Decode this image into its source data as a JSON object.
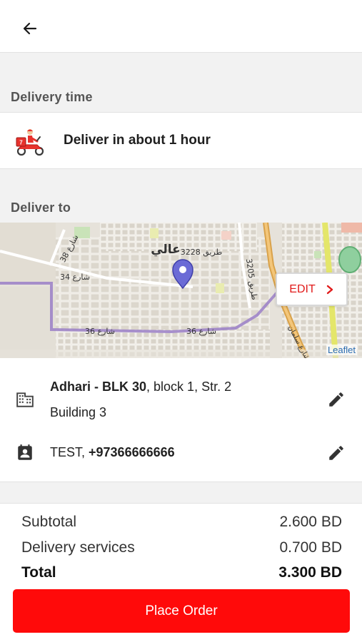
{
  "header": {
    "back_icon": "arrow-left-icon"
  },
  "delivery_time": {
    "section_label": "Delivery time",
    "text": "Deliver in about 1 hour",
    "icon": "delivery-scooter-icon"
  },
  "deliver_to": {
    "section_label": "Deliver to",
    "map": {
      "edit_label": "EDIT",
      "attribution": "Leaflet",
      "labels": {
        "area": "عالي",
        "road_3228": "طريق 3228",
        "road_3205": "طريق 3205",
        "street_34": "شارع 34",
        "street_36a": "شارع 36",
        "street_36b": "شارع 36",
        "street_38": "شارع 38",
        "street_salman": "شارع سلمان"
      }
    },
    "address": {
      "name_bold": "Adhari - BLK 30",
      "name_rest": ", block 1, Str. 2",
      "line2": "Building 3",
      "icon": "building-icon"
    },
    "contact": {
      "name": "TEST, ",
      "phone": "+97366666666",
      "icon": "contact-card-icon"
    }
  },
  "summary": {
    "subtotal_label": "Subtotal",
    "subtotal_value": "2.600 BD",
    "delivery_label": "Delivery services",
    "delivery_value": "0.700 BD",
    "total_label": "Total",
    "total_value": "3.300 BD"
  },
  "place_order_label": "Place Order",
  "colors": {
    "accent": "#ff0a0a",
    "pin": "#6b6bd6",
    "route": "#9a7fc7"
  }
}
